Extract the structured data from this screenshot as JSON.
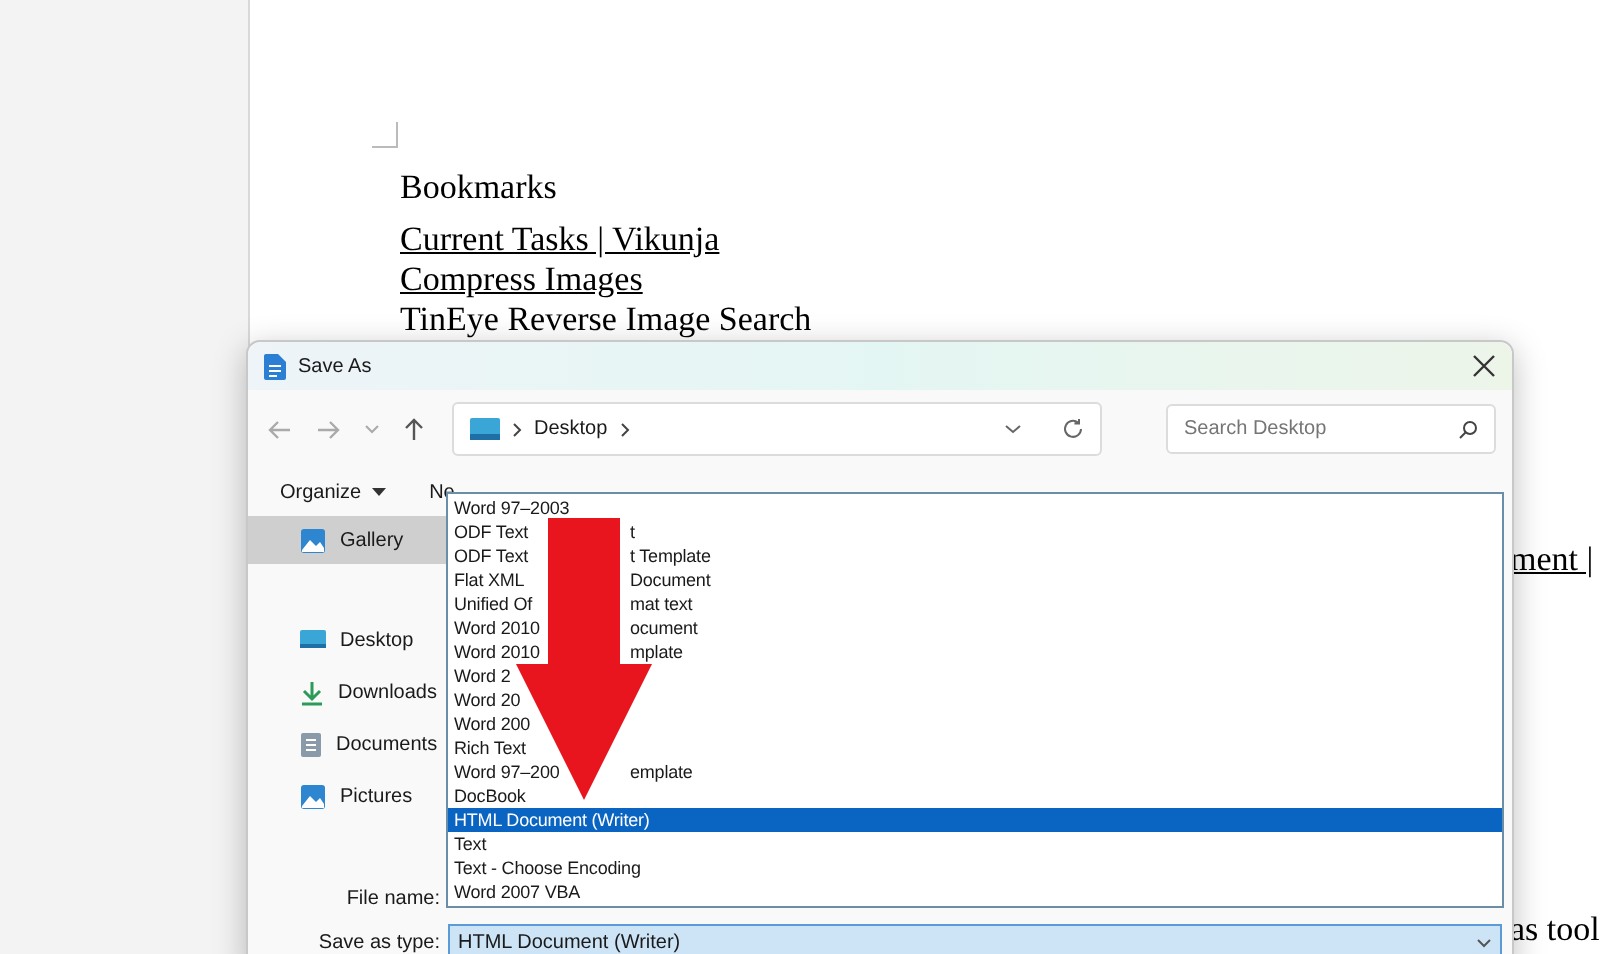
{
  "document": {
    "heading": "Bookmarks",
    "lines": [
      {
        "text": "Current Tasks | Vikunja",
        "link": true
      },
      {
        "text": "Compress Images",
        "link": true
      },
      {
        "text": "TinEye Reverse Image Search",
        "link": false
      }
    ],
    "side_lines": [
      {
        "text": "ment |",
        "link": true
      },
      {
        "text": "as tool",
        "link": false
      }
    ]
  },
  "dialog": {
    "title": "Save As",
    "address": {
      "path": [
        "Desktop"
      ]
    },
    "search": {
      "placeholder": "Search Desktop"
    },
    "toolbar": [
      "Organize",
      "Ne"
    ],
    "sidebar": [
      {
        "label": "Gallery",
        "selected": true
      },
      {
        "label": "Desktop",
        "selected": false
      },
      {
        "label": "Downloads",
        "selected": false
      },
      {
        "label": "Documents",
        "selected": false
      },
      {
        "label": "Pictures",
        "selected": false
      }
    ],
    "file_name_label": "File name:",
    "save_type_label": "Save as type:",
    "save_type_value": "HTML Document (Writer)",
    "type_list": [
      {
        "text": "Word 97–2003",
        "selected": false
      },
      {
        "text": "ODF Text",
        "tail": "t",
        "selected": false
      },
      {
        "text": "ODF Text",
        "tail": "t Template",
        "selected": false
      },
      {
        "text": "Flat XML",
        "tail": "Document",
        "selected": false
      },
      {
        "text": "Unified Of",
        "tail": "mat text",
        "selected": false
      },
      {
        "text": "Word 2010",
        "tail": "ocument",
        "selected": false
      },
      {
        "text": "Word 2010",
        "tail": "mplate",
        "selected": false
      },
      {
        "text": "Word 2",
        "selected": false
      },
      {
        "text": "Word 20",
        "selected": false
      },
      {
        "text": "Word 200",
        "selected": false
      },
      {
        "text": "Rich Text",
        "selected": false
      },
      {
        "text": "Word 97–200",
        "tail": "emplate",
        "selected": false
      },
      {
        "text": "DocBook",
        "selected": false
      },
      {
        "text": "HTML Document (Writer)",
        "selected": true
      },
      {
        "text": "Text",
        "selected": false
      },
      {
        "text": "Text - Choose Encoding",
        "selected": false
      },
      {
        "text": "Word 2007 VBA",
        "selected": false
      }
    ]
  }
}
